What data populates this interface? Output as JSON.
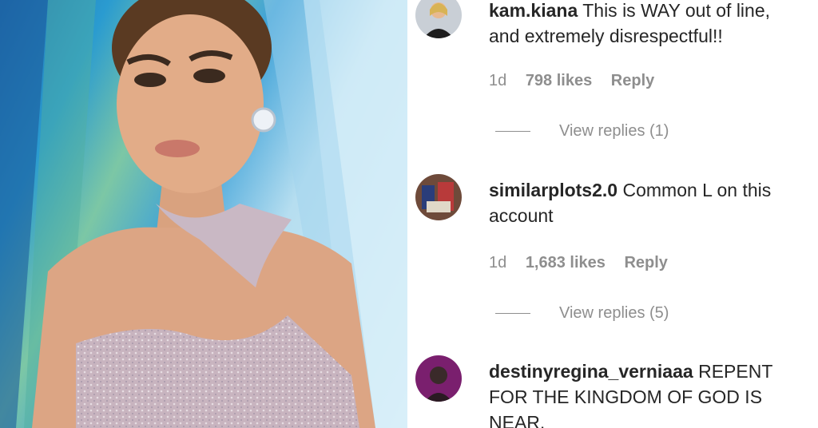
{
  "comments": [
    {
      "username": "kam.kiana",
      "text": "This is WAY out of line, and extremely disrespectful!!",
      "time": "1d",
      "likes": "798 likes",
      "reply": "Reply",
      "view_replies": "View replies (1)"
    },
    {
      "username": "similarplots2.0",
      "text": "Common L on this account",
      "time": "1d",
      "likes": "1,683 likes",
      "reply": "Reply",
      "view_replies": "View replies (5)"
    },
    {
      "username": "destinyregina_verniaaa",
      "text": "REPENT FOR THE KINGDOM OF GOD IS NEAR."
    }
  ]
}
